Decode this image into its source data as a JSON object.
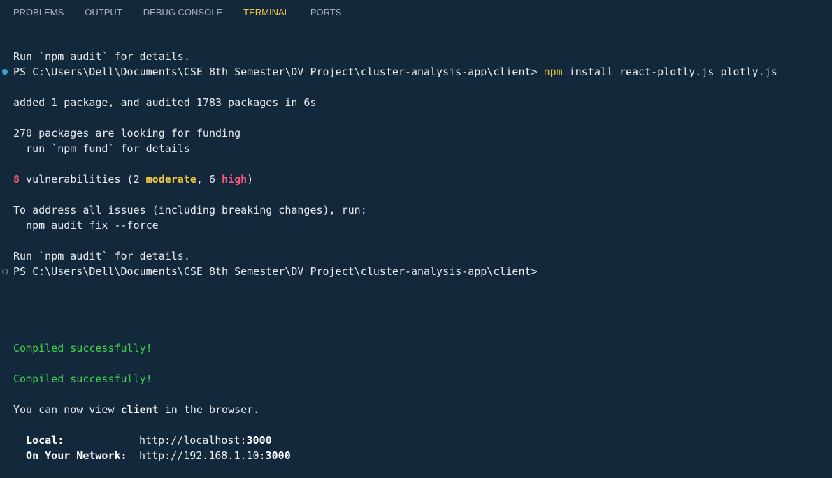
{
  "tabs": [
    {
      "label": "PROBLEMS",
      "active": false
    },
    {
      "label": "OUTPUT",
      "active": false
    },
    {
      "label": "DEBUG CONSOLE",
      "active": false
    },
    {
      "label": "TERMINAL",
      "active": true
    },
    {
      "label": "PORTS",
      "active": false
    }
  ],
  "terminal": {
    "audit_line_1": "Run `npm audit` for details.",
    "prompt_1": "PS C:\\Users\\Dell\\Documents\\CSE 8th Semester\\DV Project\\cluster-analysis-app\\client> ",
    "cmd_npm": "npm",
    "cmd_args": " install react-plotly.js plotly.js",
    "added_line": "added 1 package, and audited 1783 packages in 6s",
    "funding_line": "270 packages are looking for funding",
    "fund_hint": "  run `npm fund` for details",
    "vuln_count": "8",
    "vuln_text_a": " vulnerabilities (2 ",
    "vuln_moderate": "moderate",
    "vuln_text_b": ", 6 ",
    "vuln_high": "high",
    "vuln_text_c": ")",
    "address_line": "To address all issues (including breaking changes), run:",
    "fix_cmd": "  npm audit fix --force",
    "audit_line_2": "Run `npm audit` for details.",
    "prompt_2": "PS C:\\Users\\Dell\\Documents\\CSE 8th Semester\\DV Project\\cluster-analysis-app\\client>",
    "compiled_1": "Compiled successfully!",
    "compiled_2": "Compiled successfully!",
    "view_a": "You can now view ",
    "view_app": "client",
    "view_b": " in the browser.",
    "local_label": "  Local:",
    "local_url_a": "http://localhost:",
    "local_port": "3000",
    "network_label": "  On Your Network:",
    "network_url_a": "http://192.168.1.10:",
    "network_port": "3000"
  },
  "colors": {
    "background": "#13283b",
    "active_tab": "#f0c73e",
    "success": "#3ed34a",
    "moderate": "#f0c73e",
    "high": "#f2557b",
    "dot_success": "#3aa0d6"
  }
}
